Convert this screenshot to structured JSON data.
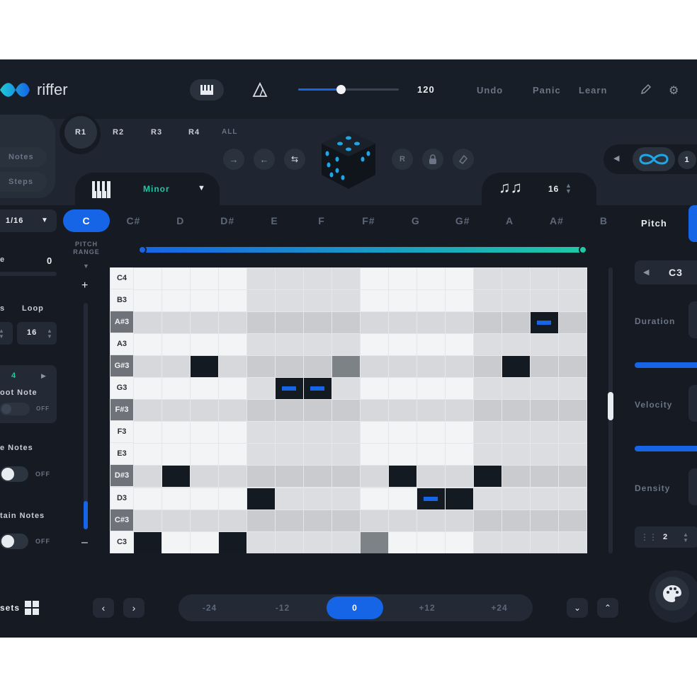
{
  "app": {
    "name": "riffer"
  },
  "header": {
    "tempo": "120",
    "tempo_level": 0.42,
    "undo": "Undo",
    "panic": "Panic",
    "learn": "Learn"
  },
  "riffs": [
    "R1",
    "R2",
    "R3",
    "R4",
    "ALL"
  ],
  "side_tabs": [
    "Notes",
    "Steps"
  ],
  "scale": {
    "name": "Minor"
  },
  "steps": {
    "count": "16"
  },
  "loop_count": "1",
  "keys": [
    "C",
    "C#",
    "D",
    "D#",
    "E",
    "F",
    "F#",
    "G",
    "G#",
    "A",
    "A#",
    "B"
  ],
  "selected_key": "C",
  "pitch_range": {
    "label": "PITCH RANGE",
    "plus": "+",
    "minus": "–"
  },
  "left_panel": {
    "rate": "1/16",
    "value_label": "e",
    "value": "0",
    "s_label": "s",
    "loop_label": "Loop",
    "loop_value": "16",
    "root_value": "4",
    "root_label": "oot Note",
    "root_toggle": "OFF",
    "notes_label": "e Notes",
    "notes_toggle": "OFF",
    "sustain_label": "tain Notes",
    "sustain_toggle": "OFF"
  },
  "right_panel": {
    "tab": "Pitch",
    "note": "C3",
    "duration": "Duration",
    "velocity": "Velocity",
    "density": "Density",
    "density_value": "2"
  },
  "grid": {
    "rows": [
      "C4",
      "B3",
      "A#3",
      "A3",
      "G#3",
      "G3",
      "F#3",
      "F3",
      "E3",
      "D#3",
      "D3",
      "C#3",
      "C3"
    ]
  },
  "bottom": {
    "presets": "sets",
    "octaves": [
      "-24",
      "-12",
      "0",
      "+12",
      "+24"
    ],
    "selected_octave": "0"
  },
  "colors": {
    "accent": "#1565e6",
    "teal": "#1fc9a6",
    "background": "#1f2631",
    "topbar": "#181e27"
  }
}
